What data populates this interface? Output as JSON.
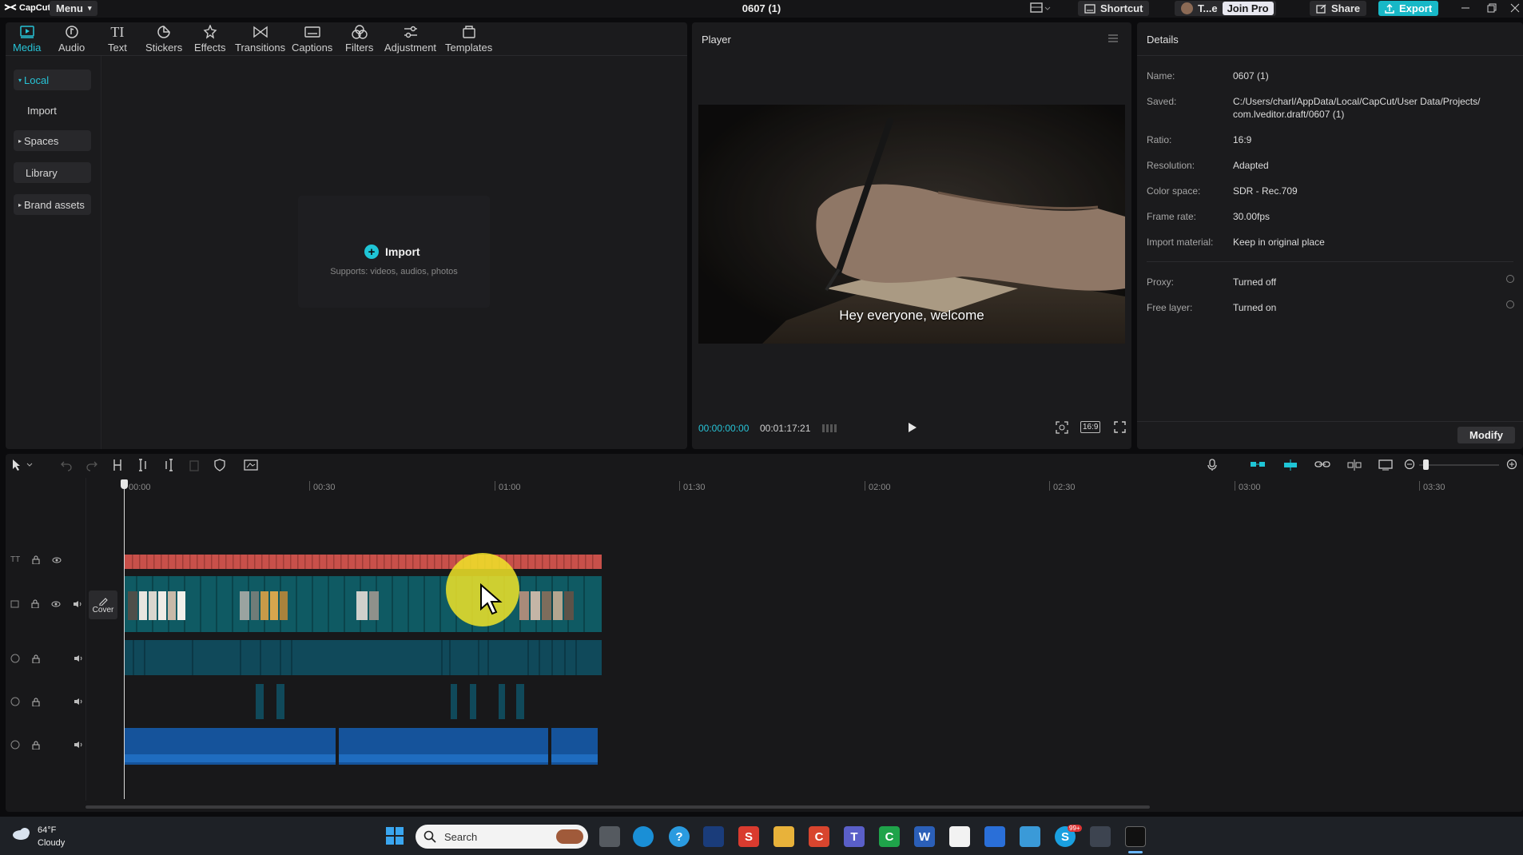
{
  "app": {
    "logo": "CapCut",
    "menu_label": "Menu",
    "project_title": "0607 (1)"
  },
  "titlebar": {
    "shortcut_label": "Shortcut",
    "user_label": "T...e",
    "join_pro_label": "Join Pro",
    "share_label": "Share",
    "export_label": "Export"
  },
  "toolbar": {
    "items": [
      {
        "label": "Media",
        "icon": "media-icon"
      },
      {
        "label": "Audio",
        "icon": "audio-icon"
      },
      {
        "label": "Text",
        "icon": "text-icon"
      },
      {
        "label": "Stickers",
        "icon": "stickers-icon"
      },
      {
        "label": "Effects",
        "icon": "effects-icon"
      },
      {
        "label": "Transitions",
        "icon": "transitions-icon"
      },
      {
        "label": "Captions",
        "icon": "captions-icon"
      },
      {
        "label": "Filters",
        "icon": "filters-icon"
      },
      {
        "label": "Adjustment",
        "icon": "adjustment-icon"
      },
      {
        "label": "Templates",
        "icon": "templates-icon"
      }
    ]
  },
  "sidebar": {
    "items": [
      {
        "label": "Local",
        "expandable": true
      },
      {
        "label": "Import",
        "expandable": false
      },
      {
        "label": "Spaces",
        "expandable": true
      },
      {
        "label": "Library",
        "expandable": false
      },
      {
        "label": "Brand assets",
        "expandable": true
      }
    ]
  },
  "media": {
    "import_label": "Import",
    "import_hint": "Supports: videos, audios, photos"
  },
  "player": {
    "title": "Player",
    "subtitle": "Hey everyone, welcome",
    "current_time": "00:00:00:00",
    "total_time": "00:01:17:21",
    "ratio_label": "16:9"
  },
  "details": {
    "title": "Details",
    "rows": [
      {
        "label": "Name:",
        "value": "0607 (1)"
      },
      {
        "label": "Saved:",
        "value": "C:/Users/charl/AppData/Local/CapCut/User Data/Projects/",
        "value2": "com.lveditor.draft/0607 (1)"
      },
      {
        "label": "Ratio:",
        "value": "16:9"
      },
      {
        "label": "Resolution:",
        "value": "Adapted"
      },
      {
        "label": "Color space:",
        "value": "SDR - Rec.709"
      },
      {
        "label": "Frame rate:",
        "value": "30.00fps"
      },
      {
        "label": "Import material:",
        "value": "Keep in original place"
      },
      {
        "label": "Proxy:",
        "value": "Turned off"
      },
      {
        "label": "Free layer:",
        "value": "Turned on"
      }
    ],
    "modify_label": "Modify"
  },
  "timeline": {
    "ruler": [
      "00:00",
      "00:30",
      "01:00",
      "01:30",
      "02:00",
      "02:30",
      "03:00",
      "03:30"
    ],
    "cover_label": "Cover"
  },
  "taskbar": {
    "temperature": "64°F",
    "weather": "Cloudy",
    "search_placeholder": "Search",
    "skype_badge": "99+"
  },
  "colors": {
    "accent": "#1fc5d6",
    "text_track": "#c8504a",
    "video_track": "#0f5a63",
    "audio_track": "#10506b",
    "music_track": "#1564a8",
    "export": "#18b8c7"
  }
}
